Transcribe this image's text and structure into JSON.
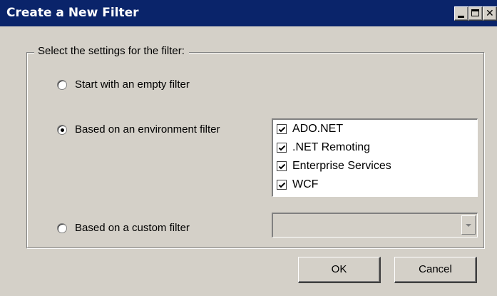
{
  "window": {
    "title": "Create a New Filter"
  },
  "group": {
    "legend": "Select the settings for the filter:"
  },
  "options": {
    "empty": {
      "label": "Start with an empty filter",
      "selected": false
    },
    "environment": {
      "label": "Based on an environment filter",
      "selected": true
    },
    "custom": {
      "label": "Based on a custom filter",
      "selected": false
    }
  },
  "environment_filters": [
    {
      "label": "ADO.NET",
      "checked": true
    },
    {
      "label": ".NET Remoting",
      "checked": true
    },
    {
      "label": "Enterprise Services",
      "checked": true
    },
    {
      "label": "WCF",
      "checked": true
    }
  ],
  "custom_filter_combo": {
    "value": "",
    "enabled": false
  },
  "buttons": {
    "ok": "OK",
    "cancel": "Cancel"
  },
  "colors": {
    "titlebar": "#0a246a",
    "face": "#d4d0c8"
  }
}
